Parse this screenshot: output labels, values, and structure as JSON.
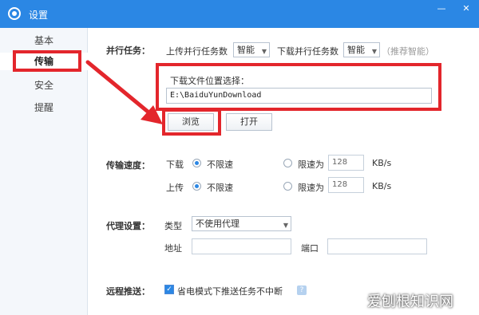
{
  "window": {
    "title": "设置",
    "minimize_glyph": "—",
    "close_glyph": "✕"
  },
  "sidebar": {
    "items": [
      {
        "label": "基本"
      },
      {
        "label": "传输"
      },
      {
        "label": "安全"
      },
      {
        "label": "提醒"
      }
    ]
  },
  "parallel": {
    "section_label": "并行任务：",
    "upload_label": "上传并行任务数",
    "upload_value": "智能",
    "download_label": "下载并行任务数",
    "download_value": "智能",
    "hint": "（推荐智能）"
  },
  "download_location": {
    "label": "下载文件位置选择：",
    "path": "E:\\BaiduYunDownload",
    "browse_label": "浏览",
    "open_label": "打开"
  },
  "speed": {
    "section_label": "传输速度：",
    "download_label": "下载",
    "upload_label": "上传",
    "unlimited_label": "不限速",
    "limit_label": "限速为",
    "download_limit_value": "128",
    "upload_limit_value": "128",
    "unit": "KB/s"
  },
  "proxy": {
    "section_label": "代理设置：",
    "type_label": "类型",
    "type_value": "不使用代理",
    "address_label": "地址",
    "port_label": "端口"
  },
  "remote_push": {
    "section_label": "远程推送：",
    "checkbox_label": "省电模式下推送任务不中断",
    "help_glyph": "?"
  },
  "watermark": "爱刨根知识网",
  "colors": {
    "title_bar": "#2b87e4",
    "annotation_red": "#e3262c"
  }
}
